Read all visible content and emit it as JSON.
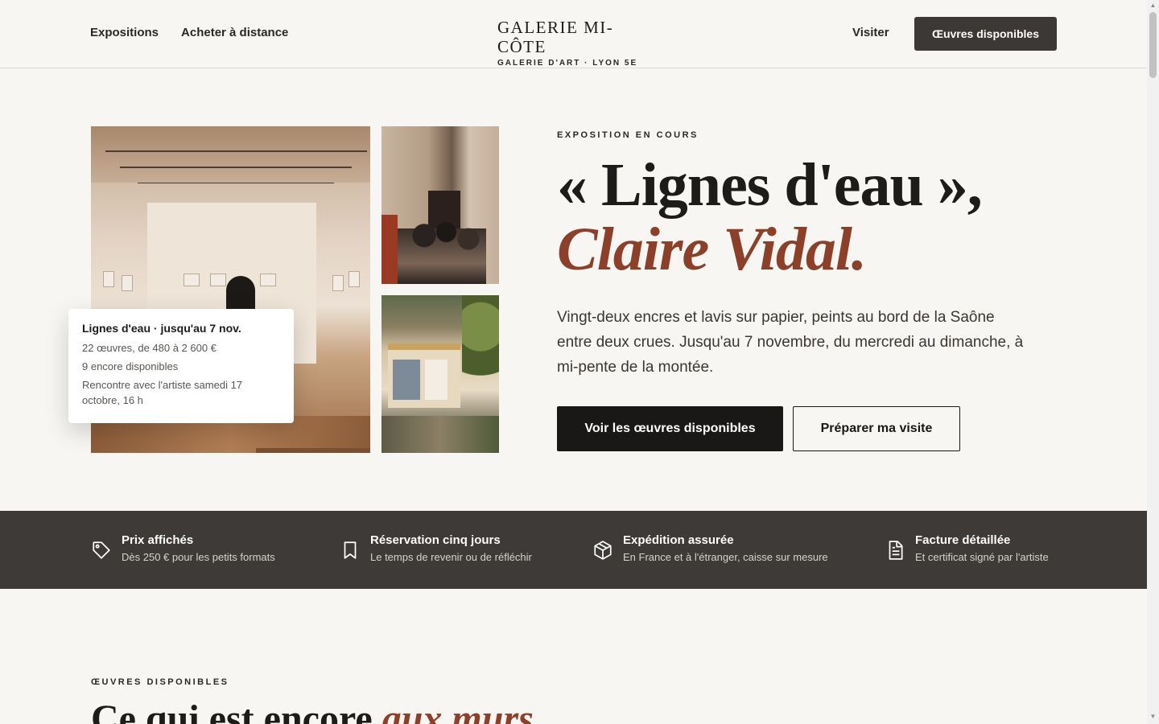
{
  "header": {
    "nav_left": [
      "Expositions",
      "Acheter à distance"
    ],
    "logo_main": "GALERIE MI-CÔTE",
    "logo_sub": "GALERIE D'ART · LYON 5E",
    "visit_label": "Visiter",
    "cta_label": "Œuvres disponibles"
  },
  "hero": {
    "eyebrow": "EXPOSITION EN COURS",
    "title_main": "« Lignes d'eau », ",
    "title_accent": "Claire Vidal.",
    "description": "Vingt-deux encres et lavis sur papier, peints au bord de la Saône entre deux crues. Jusqu'au 7 novembre, du mercredi au dimanche, à mi-pente de la montée.",
    "primary_button": "Voir les œuvres disponibles",
    "secondary_button": "Préparer ma visite"
  },
  "info_card": {
    "title": "Lignes d'eau · jusqu'au 7 nov.",
    "lines": [
      "22 œuvres, de 480 à 2 600 €",
      "9 encore disponibles",
      "Rencontre avec l'artiste samedi 17 octobre, 16 h"
    ]
  },
  "features": [
    {
      "icon": "tag-icon",
      "title": "Prix affichés",
      "subtitle": "Dès 250 € pour les petits formats"
    },
    {
      "icon": "bookmark-icon",
      "title": "Réservation cinq jours",
      "subtitle": "Le temps de revenir ou de réfléchir"
    },
    {
      "icon": "package-icon",
      "title": "Expédition assurée",
      "subtitle": "En France et à l'étranger, caisse sur mesure"
    },
    {
      "icon": "document-icon",
      "title": "Facture détaillée",
      "subtitle": "Et certificat signé par l'artiste"
    }
  ],
  "section2": {
    "eyebrow": "ŒUVRES DISPONIBLES",
    "title_main": "Ce qui est encore ",
    "title_accent": "aux murs"
  },
  "colors": {
    "accent": "#8c3f29",
    "band": "#3d3a37",
    "background": "#f8f6f3",
    "button_dark": "#1a1817"
  }
}
